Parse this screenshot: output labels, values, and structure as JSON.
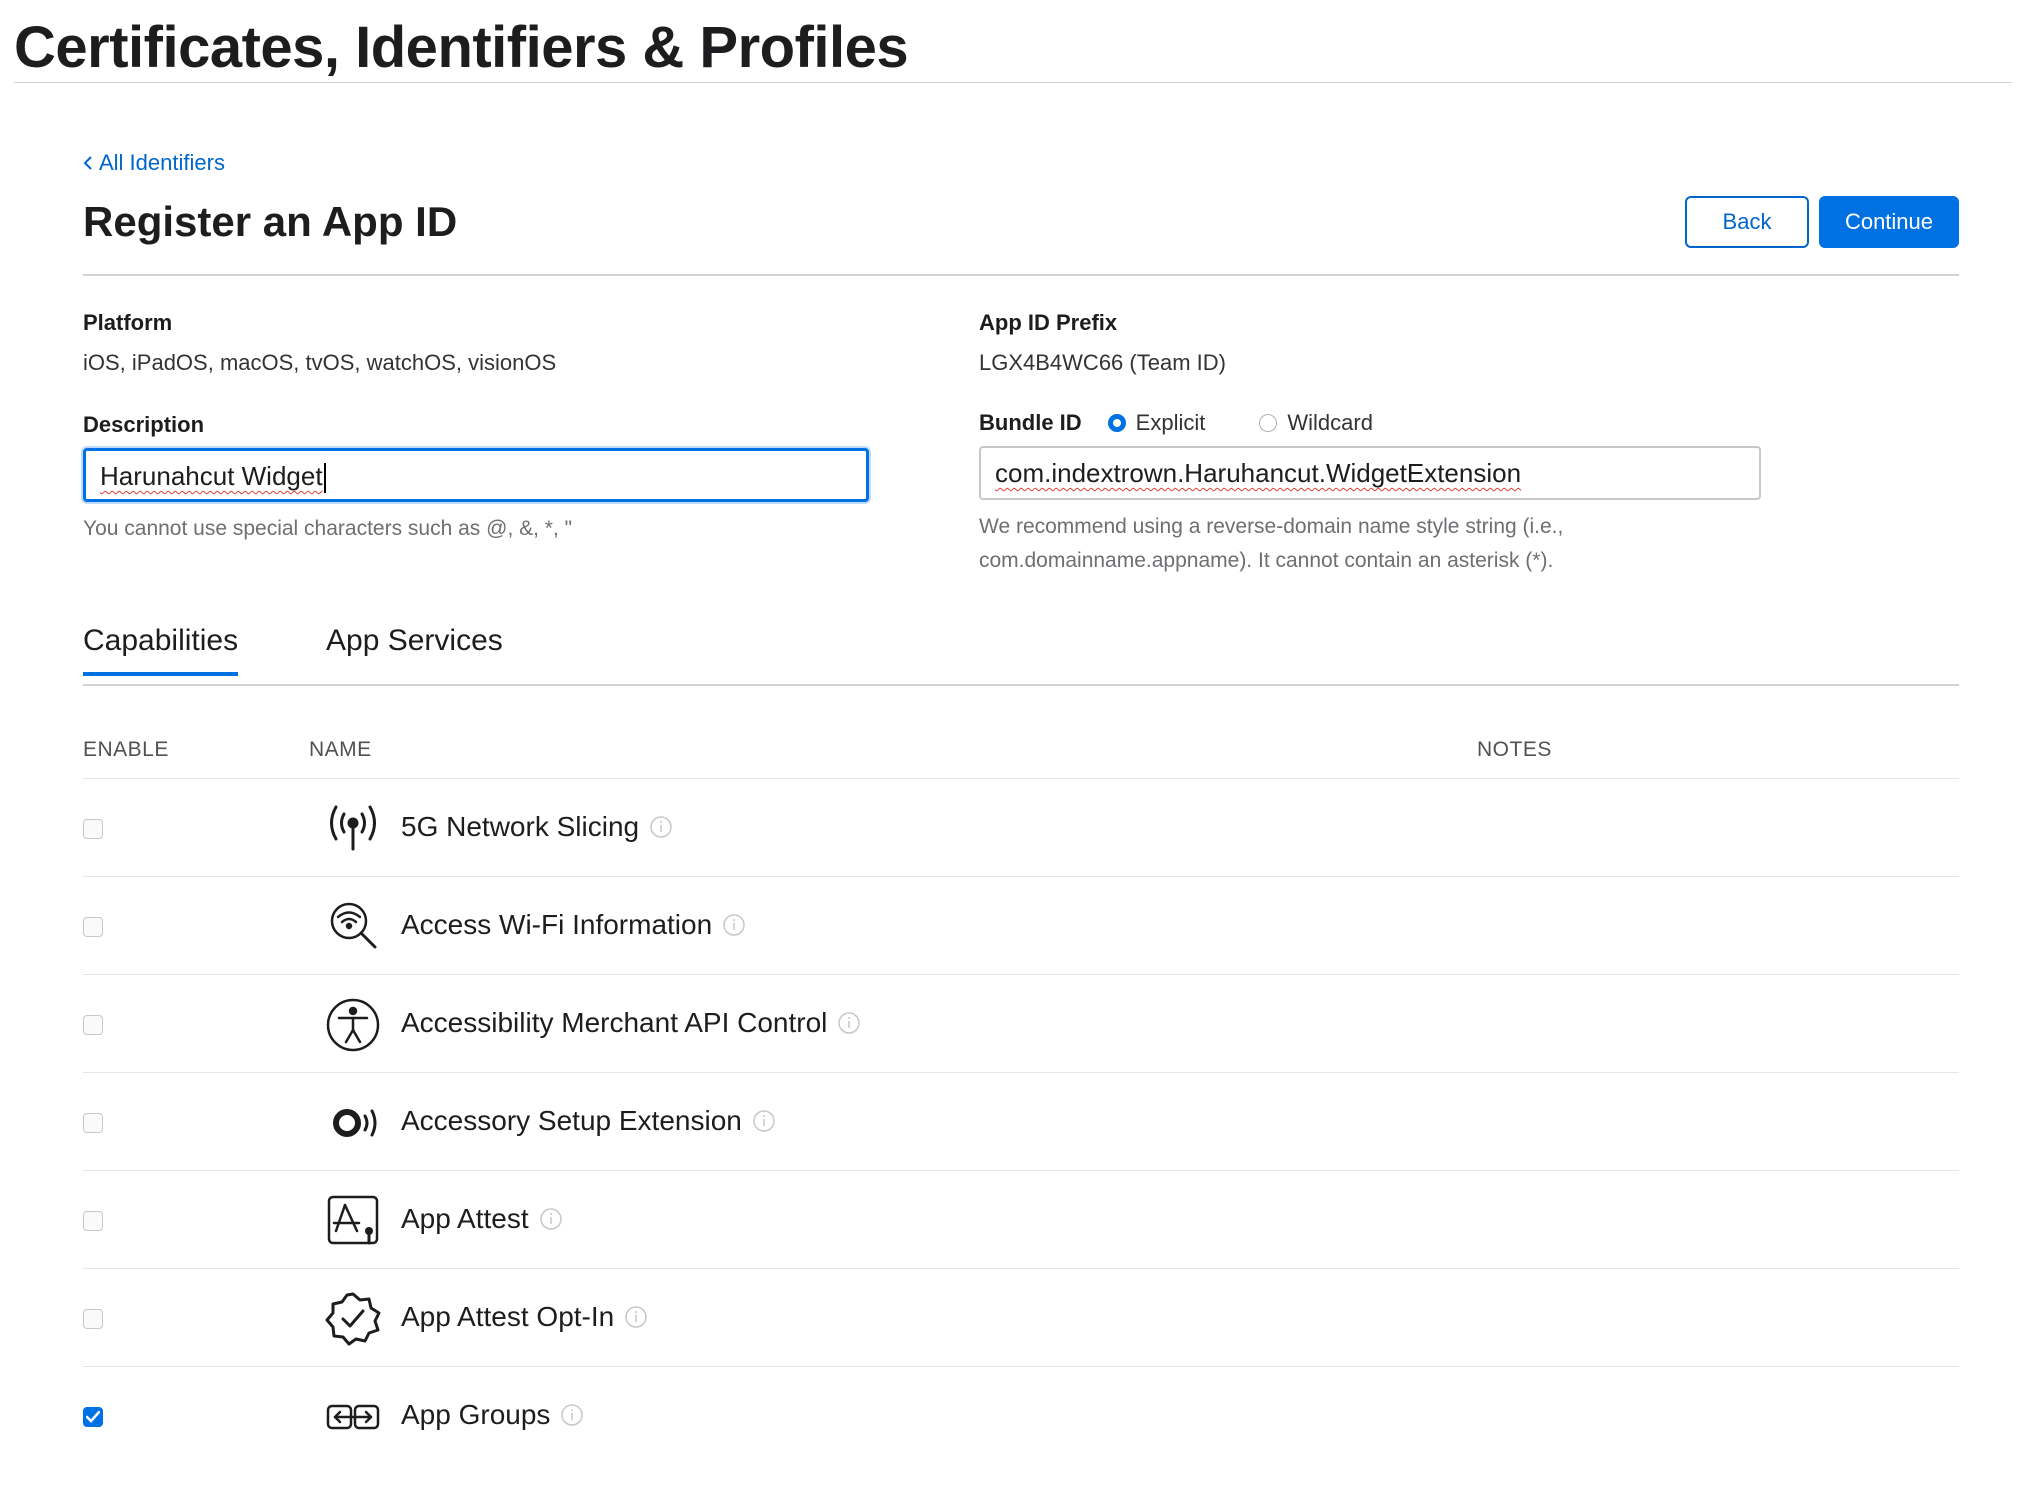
{
  "header": {
    "title": "Certificates, Identifiers & Profiles"
  },
  "nav": {
    "back_link": "All Identifiers"
  },
  "page": {
    "title": "Register an App ID",
    "back_button": "Back",
    "continue_button": "Continue"
  },
  "form": {
    "platform_label": "Platform",
    "platform_value": "iOS, iPadOS, macOS, tvOS, watchOS, visionOS",
    "prefix_label": "App ID Prefix",
    "prefix_value": "LGX4B4WC66 (Team ID)",
    "description_label": "Description",
    "description_value": "Harunahcut Widget",
    "description_hint": "You cannot use special characters such as @, &, *, \"",
    "bundle_label": "Bundle ID",
    "bundle_option_explicit": "Explicit",
    "bundle_option_wildcard": "Wildcard",
    "bundle_selected": "Explicit",
    "bundle_value": "com.indextrown.Haruhancut.WidgetExtension",
    "bundle_hint_line1": "We recommend using a reverse-domain name style string (i.e.,",
    "bundle_hint_line2": "com.domainname.appname). It cannot contain an asterisk (*)."
  },
  "tabs": [
    {
      "label": "Capabilities",
      "active": true
    },
    {
      "label": "App Services",
      "active": false
    }
  ],
  "table": {
    "col_enable": "ENABLE",
    "col_name": "NAME",
    "col_notes": "NOTES"
  },
  "capabilities": [
    {
      "name": "5G Network Slicing",
      "icon": "antenna-icon",
      "enabled": false
    },
    {
      "name": "Access Wi-Fi Information",
      "icon": "wifi-search-icon",
      "enabled": false
    },
    {
      "name": "Accessibility Merchant API Control",
      "icon": "accessibility-icon",
      "enabled": false
    },
    {
      "name": "Accessory Setup Extension",
      "icon": "accessory-icon",
      "enabled": false
    },
    {
      "name": "App Attest",
      "icon": "app-attest-icon",
      "enabled": false
    },
    {
      "name": "App Attest Opt-In",
      "icon": "verified-badge-icon",
      "enabled": false
    },
    {
      "name": "App Groups",
      "icon": "app-groups-icon",
      "enabled": true
    }
  ],
  "colors": {
    "accent": "#0071e3",
    "link": "#0066cc",
    "text": "#1d1d1f",
    "muted": "#6e6e73"
  }
}
